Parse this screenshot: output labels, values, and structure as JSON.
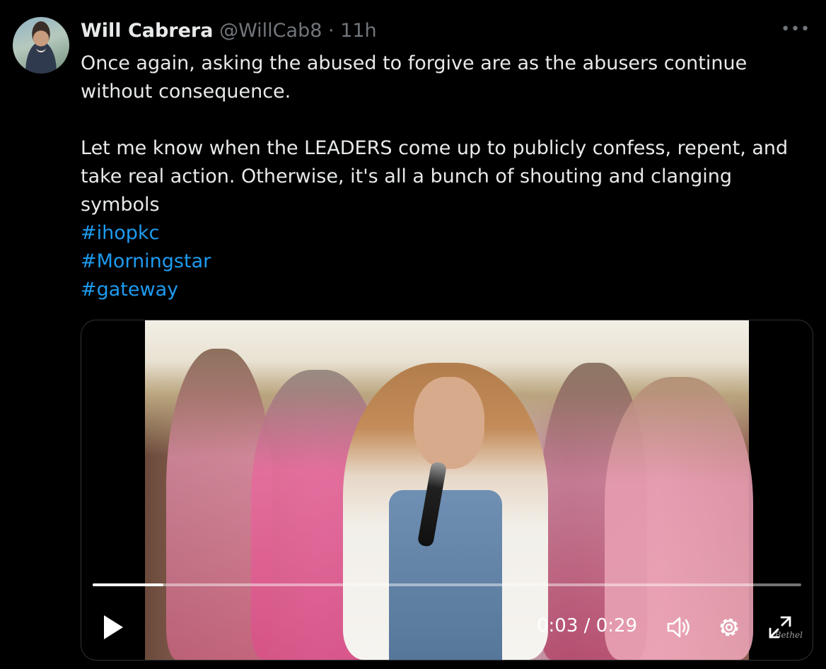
{
  "tweet": {
    "author_name": "Will Cabrera",
    "handle": "@WillCab8",
    "separator": "·",
    "time": "11h",
    "more_icon": "more-horizontal-icon",
    "paragraph_1": "Once again, asking the abused to forgive are as the abusers continue without consequence.",
    "paragraph_2": "Let me know when the LEADERS come up to publicly confess, repent, and take real action. Otherwise, it's all a bunch of shouting and clanging symbols",
    "hashtags": [
      "#ihopkc",
      "#Morningstar",
      "#gateway"
    ]
  },
  "video": {
    "current_time": "0:03",
    "duration": "0:29",
    "time_separator": " / ",
    "progress_fraction": 0.1,
    "watermark": "Bethel"
  },
  "colors": {
    "background": "#000000",
    "text": "#e7e9ea",
    "muted": "#71767b",
    "link": "#1d9bf0"
  }
}
